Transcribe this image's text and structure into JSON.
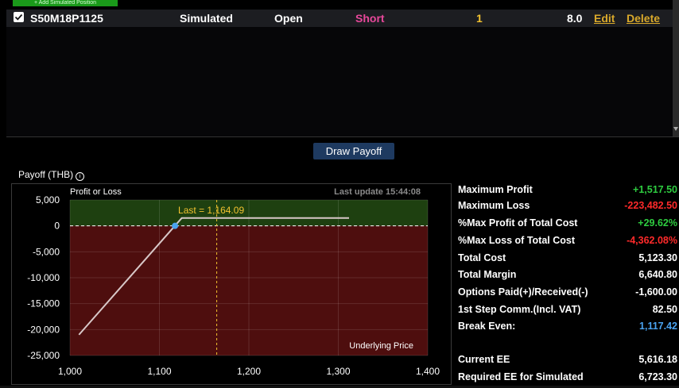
{
  "toolbar": {
    "add_label": "+ Add Simulated Position"
  },
  "position": {
    "symbol": "S50M18P1125",
    "type": "Simulated",
    "status": "Open",
    "side": "Short",
    "quantity": "1",
    "price": "8.0",
    "edit_label": "Edit",
    "delete_label": "Delete"
  },
  "draw_button": "Draw Payoff",
  "payoff_title": "Payoff (THB)",
  "colors": {
    "profit_zone": "#1e4010",
    "loss_zone": "#4e0e0e",
    "positive": "#2ecc40",
    "negative": "#ff2a2a",
    "accent": "#f2c230",
    "short": "#e8489b",
    "break_even": "#4aa3f0"
  },
  "chart_data": {
    "type": "line",
    "ylabel": "Profit or Loss",
    "xlabel": "Underlying Price",
    "last_update": "Last update 15:44:08",
    "last_label": "Last = 1,164.09",
    "last_value": 1164.09,
    "break_even": 1117.42,
    "xlim": [
      1000,
      1400
    ],
    "ylim": [
      -25000,
      5000
    ],
    "x_ticks": [
      1000,
      1100,
      1200,
      1300,
      1400
    ],
    "x_tick_labels": [
      "1,000",
      "1,100",
      "1,200",
      "1,300",
      "1,400"
    ],
    "y_ticks": [
      5000,
      0,
      -5000,
      -10000,
      -15000,
      -20000,
      -25000
    ],
    "y_tick_labels": [
      "5,000",
      "0",
      "-5,000",
      "-10,000",
      "-15,000",
      "-20,000",
      "-25,000"
    ],
    "series": [
      {
        "x": [
          1010,
          1125,
          1312
        ],
        "y": [
          -21000,
          1517.5,
          1517.5
        ]
      }
    ]
  },
  "stats": [
    {
      "label": "Maximum Profit",
      "value": "+1,517.50",
      "color": "#2ecc40"
    },
    {
      "label": "Maximum Loss",
      "value": "-223,482.50",
      "color": "#ff2a2a"
    },
    {
      "label": "%Max Profit of Total Cost",
      "value": "+29.62%",
      "color": "#2ecc40"
    },
    {
      "label": "%Max Loss of Total Cost",
      "value": "-4,362.08%",
      "color": "#ff2a2a"
    },
    {
      "label": "Total Cost",
      "value": "5,123.30",
      "color": "#ffffff"
    },
    {
      "label": "Total Margin",
      "value": "6,640.80",
      "color": "#ffffff"
    },
    {
      "label": "Options Paid(+)/Received(-)",
      "value": "-1,600.00",
      "color": "#ffffff"
    },
    {
      "label": "1st Step Comm.(Incl. VAT)",
      "value": "82.50",
      "color": "#ffffff"
    },
    {
      "label": "Break Even:",
      "value": "1,117.42",
      "color": "#4aa3f0"
    },
    {
      "label": "Current EE",
      "value": "5,616.18",
      "color": "#ffffff"
    },
    {
      "label": "Required EE for Simulated",
      "value": "6,723.30",
      "color": "#ffffff"
    }
  ]
}
